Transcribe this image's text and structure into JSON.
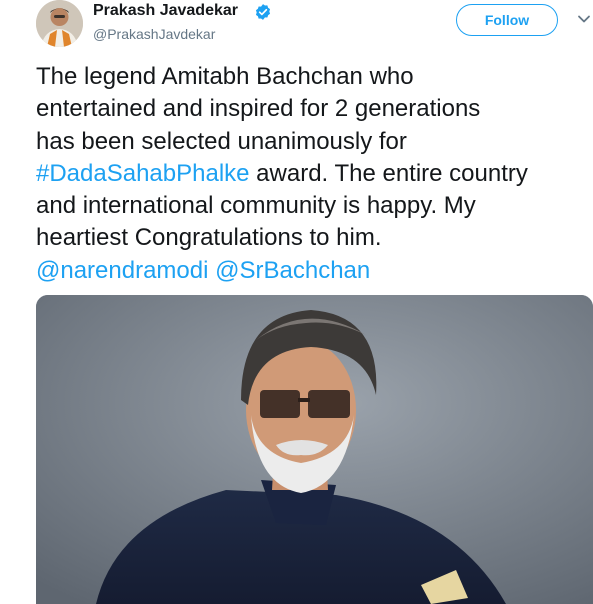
{
  "author": {
    "display_name": "Prakash Javadekar",
    "handle": "@PrakashJavdekar",
    "verified": true
  },
  "actions": {
    "follow_label": "Follow",
    "more_icon": "chevron-down-icon"
  },
  "tweet": {
    "text_1": "The legend Amitabh Bachchan who\nentertained and inspired for 2 generations\nhas been selected unanimously for\n",
    "hashtag": "#DadaSahabPhalke",
    "text_2": " award. The entire country\nand international community is happy. My\nheartiest Congratulations to him.\n",
    "mention_1": "@narendramodi",
    "space": " ",
    "mention_2": "@SrBachchan"
  },
  "colors": {
    "link": "#1da1f2",
    "text": "#14171a",
    "secondary": "#657786"
  }
}
